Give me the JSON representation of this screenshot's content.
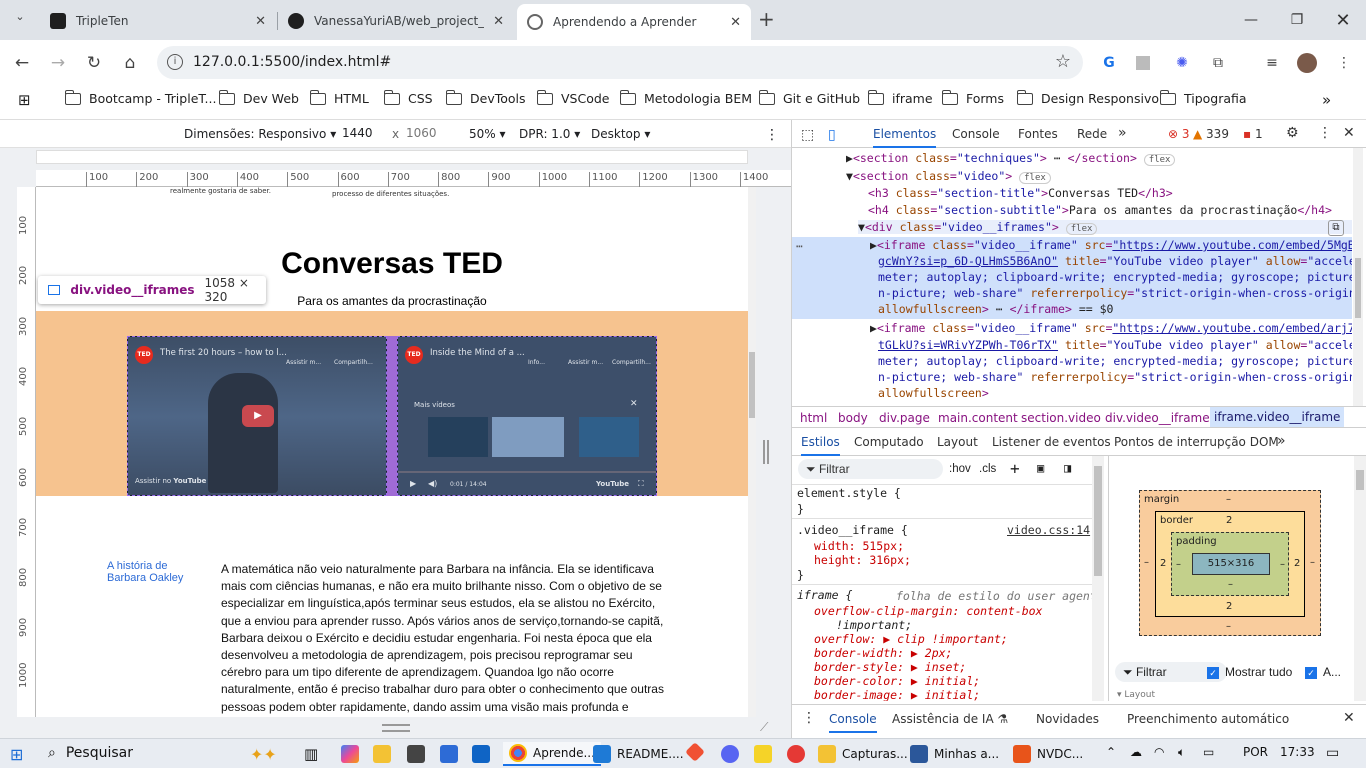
{
  "browser": {
    "tabs": [
      {
        "title": "TripleTen",
        "active": false
      },
      {
        "title": "VanessaYuriAB/web_project_co",
        "active": false
      },
      {
        "title": "Aprendendo a Aprender",
        "active": true
      }
    ],
    "new_tab": "+",
    "url": "127.0.0.1:5500/index.html#",
    "bookmarks": [
      "Bootcamp - TripleT...",
      "Dev Web",
      "HTML",
      "CSS",
      "DevTools",
      "VSCode",
      "Metodologia BEM",
      "Git e GitHub",
      "iframe",
      "Forms",
      "Design Responsivo",
      "Tipografia"
    ],
    "bookmarks_more": "»"
  },
  "device_toolbar": {
    "dimensions": "Dimensões: Responsivo",
    "width": "1440",
    "times": "x",
    "height": "1060",
    "zoom": "50%",
    "dpr": "DPR: 1.0",
    "mode": "Desktop"
  },
  "rulers": {
    "h": [
      "100",
      "200",
      "300",
      "400",
      "500",
      "600",
      "700",
      "800",
      "900",
      "1000",
      "1100",
      "1200",
      "1300",
      "1400"
    ],
    "v": [
      "100",
      "200",
      "300",
      "400",
      "500",
      "600",
      "700",
      "800",
      "900",
      "1000"
    ]
  },
  "page": {
    "top_text_left": "realmente gostaria de saber.",
    "top_text_right": "processo de diferentes situações.",
    "title": "Conversas TED",
    "subtitle": "Para os amantes da procrastinação",
    "tooltip_name": "div.video__iframes",
    "tooltip_size": "1058 × 320",
    "video1_title": "The first 20 hours – how to l...",
    "video1_later": "Assistir m...",
    "video1_share": "Compartilh...",
    "video1_watch": "Assistir no",
    "video2_title": "Inside the Mind of a ...",
    "video2_info": "Info...",
    "video2_later": "Assistir m...",
    "video2_share": "Compartilh...",
    "video2_more": "Mais vídeos",
    "video2_time": "0:01 / 14:04",
    "youtube": "YouTube",
    "ted": "TED",
    "history_title": "A história de Barbara Oakley",
    "history_text": "A matemática não veio naturalmente para Barbara na infância. Ela se identificava mais com ciências humanas, e não era muito brilhante nisso. Com o objetivo de se especializar em linguística,após terminar seus estudos, ela se alistou no Exército, que a enviou para aprender russo. Após vários anos de serviço,tornando-se capitã, Barbara deixou o Exército e decidiu estudar engenharia. Foi nesta época que ela desenvolveu a metodologia de aprendizagem, pois precisou reprogramar seu cérebro para um tipo diferente de aprendizagem. Quandoa lgo não ocorre naturalmente, então é preciso trabalhar duro para obter o conhecimento que outras pessoas podem obter rapidamente, dando assim uma visão mais profunda e"
  },
  "devtools": {
    "tabs": [
      "Elementos",
      "Console",
      "Fontes",
      "Rede"
    ],
    "more": "»",
    "errors": "3",
    "warnings": "339",
    "issues": "1",
    "breadcrumbs": [
      "html",
      "body",
      "div.page",
      "main.content",
      "section.video",
      "div.video__iframes",
      "iframe.video__iframe"
    ],
    "style_tabs": [
      "Estilos",
      "Computado",
      "Layout",
      "Listener de eventos",
      "Pontos de interrupção DOM"
    ],
    "filter_placeholder": "Filtrar",
    "hov": ":hov",
    "cls": ".cls",
    "rule1_selector": "element.style {",
    "rule2_selector": ".video__iframe {",
    "rule2_source": "video.css:14",
    "rule2_props": [
      "width: 515px;",
      "height: 316px;"
    ],
    "rule3_selector": "iframe {",
    "rule3_source": "folha de estilo do user agent",
    "rule3_props": [
      "overflow-clip-margin: content-box",
      "!important;",
      "overflow: ▶ clip !important;",
      "border-width: ▶ 2px;",
      "border-style: ▶ inset;",
      "border-color: ▶ initial;",
      "border-image: ▶ initial;"
    ],
    "box": {
      "margin": "margin",
      "border": "border",
      "padding": "padding",
      "content": "515×316",
      "dash": "–",
      "two": "2"
    },
    "computed_filter": "Filtrar",
    "show_all": "Mostrar tudo",
    "a_label": "A...",
    "layout_label": "Layout",
    "drawer_tabs": [
      "Console",
      "Assistência de IA",
      "Novidades",
      "Preenchimento automático"
    ]
  },
  "taskbar": {
    "search": "Pesquisar",
    "apps": [
      "Aprende...",
      "README....",
      "Capturas...",
      "Minhas a...",
      "NVDC..."
    ],
    "lang": "POR",
    "time": "17:33"
  }
}
